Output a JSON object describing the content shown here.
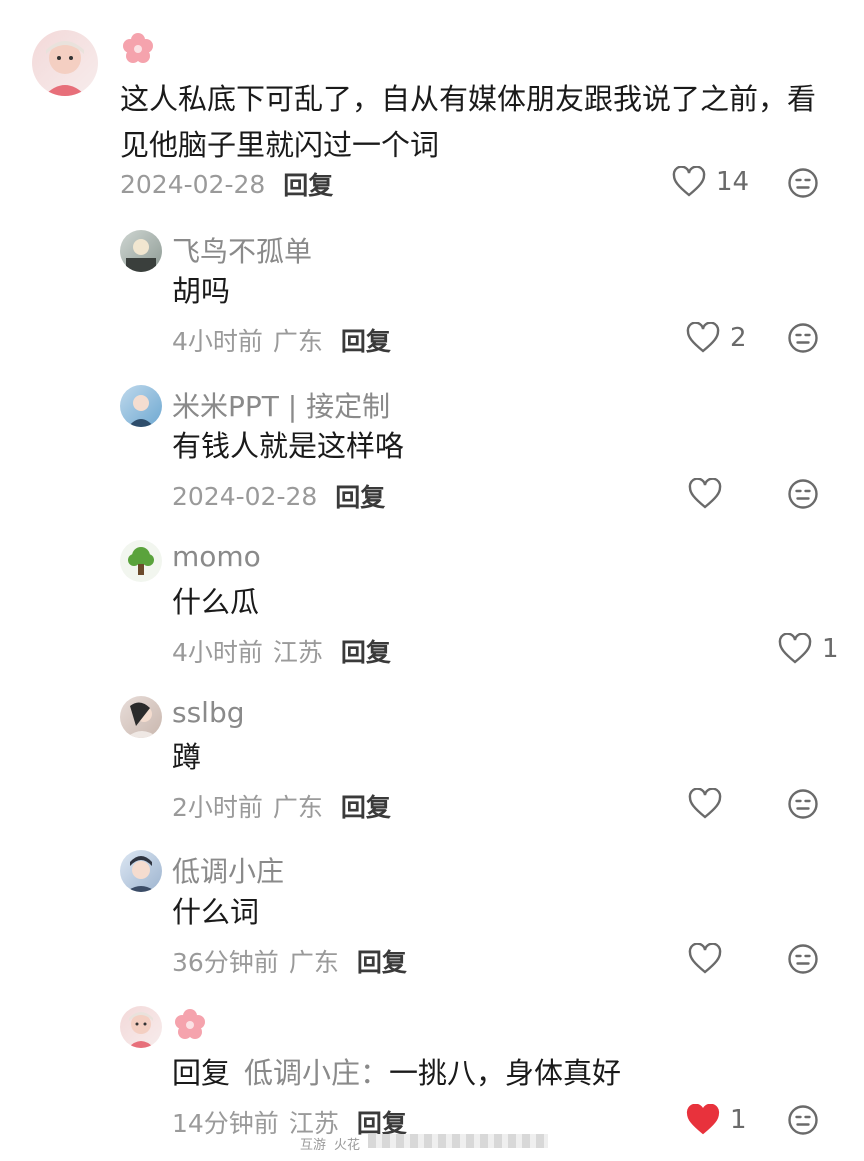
{
  "main_comment": {
    "text": "这人私底下可乱了，自从有媒体朋友跟我说了之前，看见他脑子里就闪过一个词",
    "date": "2024-02-28",
    "reply_label": "回复",
    "likes": "14",
    "avatar_icon": "girl-avatar",
    "badge_icon": "flower-icon"
  },
  "replies": [
    {
      "name": "飞鸟不孤单",
      "text": "胡吗",
      "time": "4小时前",
      "location": "广东",
      "reply_label": "回复",
      "likes": "2"
    },
    {
      "name": "米米PPT | 接定制",
      "text": "有钱人就是这样咯",
      "time": "2024-02-28",
      "location": "",
      "reply_label": "回复",
      "likes": ""
    },
    {
      "name": "momo",
      "text": "什么瓜",
      "time": "4小时前",
      "location": "江苏",
      "reply_label": "回复",
      "likes": "1"
    },
    {
      "name": "sslbg",
      "text": "蹲",
      "time": "2小时前",
      "location": "广东",
      "reply_label": "回复",
      "likes": ""
    },
    {
      "name": "低调小庄",
      "text": "什么词",
      "time": "36分钟前",
      "location": "广东",
      "reply_label": "回复",
      "likes": ""
    },
    {
      "name": "",
      "reply_prefix": "回复",
      "reply_target": "低调小庄：",
      "text": "一挑八，身体真好",
      "time": "14分钟前",
      "location": "江苏",
      "reply_label": "回复",
      "likes": "1",
      "liked": true
    }
  ],
  "watermark": {
    "left": "互游",
    "right": "火花"
  },
  "colors": {
    "liked_heart": "#e8323c",
    "muted": "#9a9a9a"
  }
}
